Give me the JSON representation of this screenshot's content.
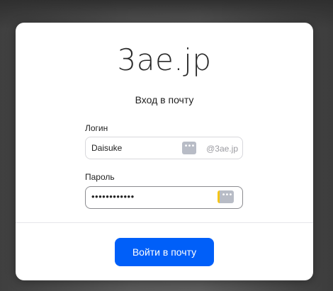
{
  "dialog": {
    "logo": "3ae.jp",
    "subtitle": "Вход в почту",
    "login": {
      "label": "Логин",
      "value": "Daisuke",
      "domain": "@3ae.jp"
    },
    "password": {
      "label": "Пароль",
      "value": "••••••••••••"
    },
    "submit_label": "Войти в почту",
    "password_manager_icon": "•••",
    "accent_color": "#005ff9"
  }
}
